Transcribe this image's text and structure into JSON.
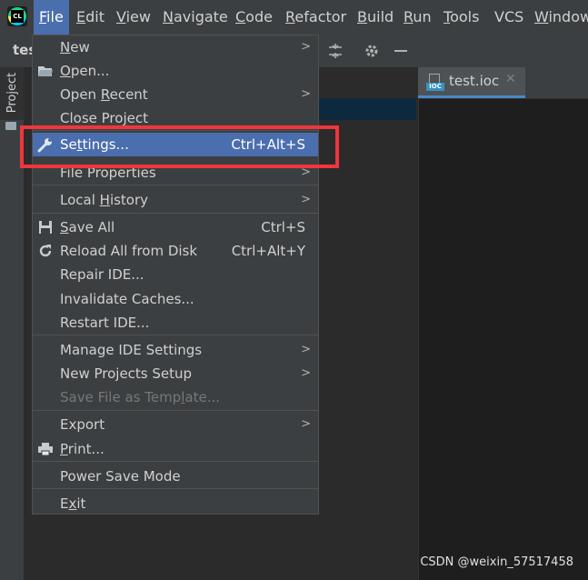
{
  "app": {
    "logo_text": "CL"
  },
  "menubar": {
    "items": [
      {
        "label": "File",
        "mnemonic_first": "F",
        "rest": "ile"
      },
      {
        "label": "Edit",
        "mnemonic_first": "E",
        "rest": "dit"
      },
      {
        "label": "View",
        "mnemonic_first": "V",
        "rest": "iew"
      },
      {
        "label": "Navigate",
        "mnemonic_first": "N",
        "rest": "avigate"
      },
      {
        "label": "Code",
        "mnemonic_first": "C",
        "rest": "ode"
      },
      {
        "label": "Refactor",
        "mnemonic_first": "R",
        "rest": "efactor"
      },
      {
        "label": "Build",
        "mnemonic_first": "B",
        "rest": "uild"
      },
      {
        "label": "Run",
        "mnemonic_first": "R",
        "rest": "un"
      },
      {
        "label": "Tools",
        "mnemonic_first": "T",
        "rest": "ools"
      },
      {
        "label": "VCS",
        "mnemonic_first": "",
        "rest": "VCS"
      },
      {
        "label": "Window",
        "mnemonic_first": "W",
        "rest": "indow"
      }
    ]
  },
  "toolbar": {
    "project_name": "tes"
  },
  "sidebar": {
    "project_tab": "Project"
  },
  "editor": {
    "tab_title": "test.ioc",
    "tab_icon_label": "IOC"
  },
  "file_menu": {
    "items": [
      {
        "pre": "",
        "ul": "N",
        "post": "ew"
      },
      {
        "pre": "",
        "ul": "O",
        "post": "pen..."
      },
      {
        "pre": "Open ",
        "ul": "R",
        "post": "ecent"
      },
      {
        "pre": "Close Pro",
        "ul": "j",
        "post": "ect"
      },
      {
        "pre": "Se",
        "ul": "t",
        "post": "tings...",
        "shortcut": "Ctrl+Alt+S"
      },
      {
        "pre": "File Properties",
        "ul": "",
        "post": ""
      },
      {
        "pre": "Local ",
        "ul": "H",
        "post": "istory"
      },
      {
        "pre": "",
        "ul": "S",
        "post": "ave All",
        "shortcut": "Ctrl+S"
      },
      {
        "pre": "Reload All from Disk",
        "ul": "",
        "post": "",
        "shortcut": "Ctrl+Alt+Y"
      },
      {
        "pre": "Repair IDE...",
        "ul": "",
        "post": ""
      },
      {
        "pre": "Invalidate Caches...",
        "ul": "",
        "post": ""
      },
      {
        "pre": "Restart IDE...",
        "ul": "",
        "post": ""
      },
      {
        "pre": "Manage IDE Settings",
        "ul": "",
        "post": ""
      },
      {
        "pre": "New Projects Setup",
        "ul": "",
        "post": ""
      },
      {
        "pre": "Save File as Temp",
        "ul": "l",
        "post": "ate..."
      },
      {
        "pre": "Export",
        "ul": "",
        "post": ""
      },
      {
        "pre": "",
        "ul": "P",
        "post": "rint..."
      },
      {
        "pre": "Power Save Mode",
        "ul": "",
        "post": ""
      },
      {
        "pre": "E",
        "ul": "x",
        "post": "it"
      }
    ]
  },
  "watermark": "CSDN @weixin_57517458",
  "colors": {
    "accent": "#4b6eaf",
    "highlight_box": "#f0363c"
  }
}
